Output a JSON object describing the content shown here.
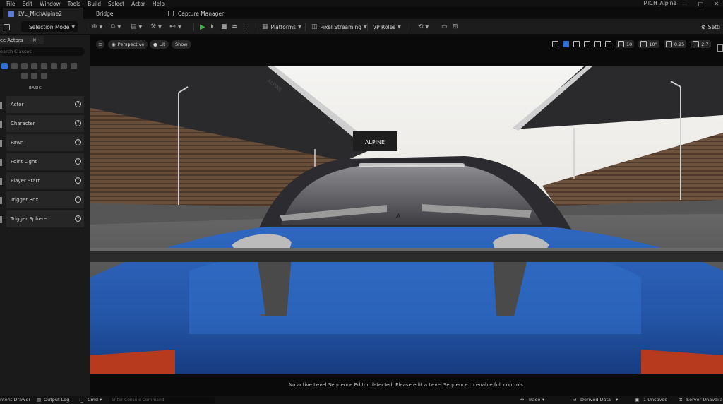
{
  "menu": {
    "items": [
      "File",
      "Edit",
      "Window",
      "Tools",
      "Build",
      "Select",
      "Actor",
      "Help"
    ],
    "project_name": "MICH_Alpine",
    "window_controls": [
      "—",
      "□",
      "✕"
    ]
  },
  "tabs": {
    "level": "LVL_MichAlpine2",
    "bridge": "Bridge",
    "capture": "Capture Manager"
  },
  "toolbar": {
    "selection_mode": "Selection Mode",
    "platforms": "Platforms",
    "pixel_streaming": "Pixel Streaming",
    "vp_roles": "VP Roles",
    "settings": "Setti"
  },
  "place_actors": {
    "tab_label": "ce Actors",
    "close": "✕",
    "search_placeholder": "earch Classes",
    "category_label": "BASIC",
    "items": [
      "Actor",
      "Character",
      "Pawn",
      "Point Light",
      "Player Start",
      "Trigger Box",
      "Trigger Sphere"
    ]
  },
  "viewport": {
    "perspective": "Perspective",
    "lit": "Lit",
    "show": "Show",
    "grid_size": "10",
    "rotation_snap": "10°",
    "scale_snap": "0.25",
    "camera_speed": "2.7",
    "sequence_message": "No active Level Sequence Editor detected. Please edit a Level Sequence to enable full controls.",
    "billboard_text": "ALPINE",
    "stand_text": "ALPINE"
  },
  "status": {
    "content_drawer": "ntent Drawer",
    "output_log": "Output Log",
    "cmd": "Cmd",
    "console_placeholder": "Enter Console Command",
    "trace": "Trace",
    "derived_data": "Derived Data",
    "unsaved": "1 Unsaved",
    "server": "Server Unavailab"
  },
  "colors": {
    "car_blue": "#2b62b8",
    "accent_blue": "#2f6fd6",
    "play_green": "#3db43d"
  }
}
